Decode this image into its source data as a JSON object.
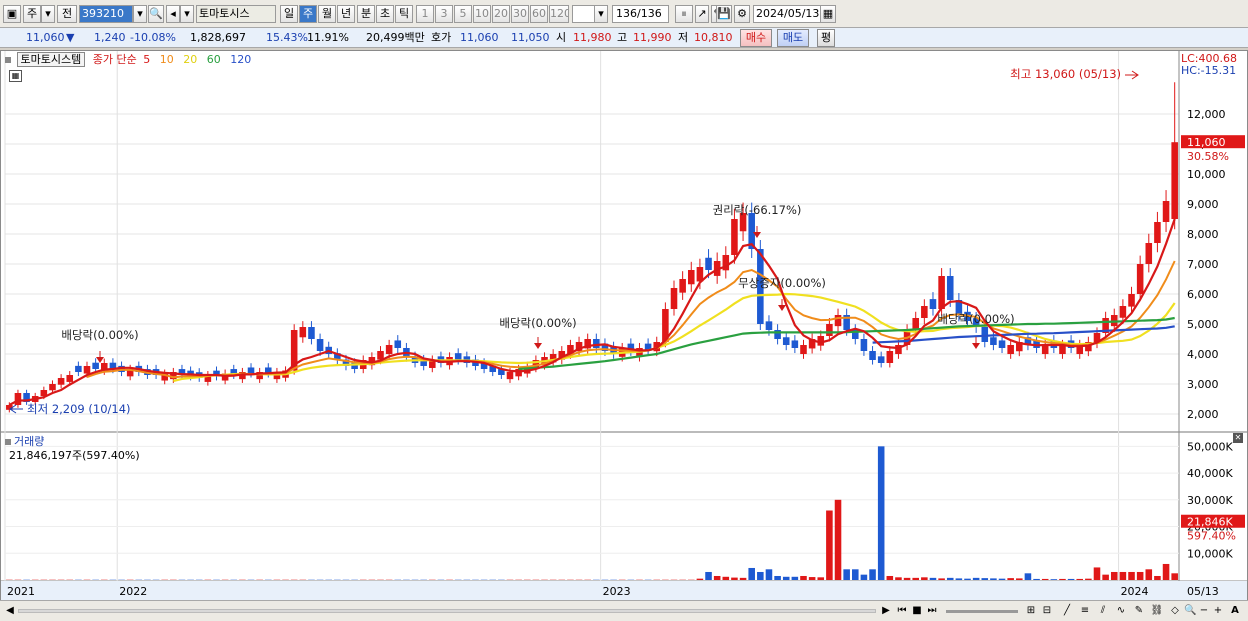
{
  "toolbar": {
    "market": "주",
    "prev": "전",
    "code": "393210",
    "stock_name": "토마토시스",
    "periods": [
      "일",
      "주",
      "월",
      "년",
      "분",
      "초",
      "틱"
    ],
    "selected_period": "주",
    "intervals": [
      "1",
      "3",
      "5",
      "10",
      "20",
      "30",
      "60",
      "120"
    ],
    "count": "136",
    "count_total": "/136",
    "date": "2024/05/13"
  },
  "info": {
    "price": "11,060",
    "change": "1,240",
    "change_pct": "-10.08%",
    "volume": "1,828,697",
    "vol_ratio": "15.43%",
    "turnover": "11.91%",
    "amount": "20,499백만",
    "ask_label": "호가",
    "ask1": "11,060",
    "ask2": "11,050",
    "open_label": "시",
    "open": "11,980",
    "high_label": "고",
    "high": "11,990",
    "low_label": "저",
    "low": "10,810",
    "buy": "매수",
    "sell": "매도",
    "avg": "평"
  },
  "legend": {
    "name": "토마토시스템",
    "type": "종가 단순",
    "ma": [
      {
        "label": "5",
        "color": "#d81818"
      },
      {
        "label": "10",
        "color": "#f08c1a"
      },
      {
        "label": "20",
        "color": "#f0e020"
      },
      {
        "label": "60",
        "color": "#2aa040"
      },
      {
        "label": "120",
        "color": "#2850c8"
      }
    ]
  },
  "lc_label": "LC:400.68",
  "hc_label": "HC:-15.31",
  "current_price": "11,060",
  "current_pct": "30.58%",
  "volume_panel": {
    "title": "거래량",
    "value": "21,846,197주(597.40%)",
    "current_label": "21,846K",
    "current_pct": "597.40%"
  },
  "annotations": {
    "high": "최고 13,060 (05/13)",
    "low": "최저 2,209 (10/14)",
    "div1": "배당락(0.00%)",
    "div2": "배당락(0.00%)",
    "rights": "권리락(-66.17%)",
    "bonus": "무상증자(0.00%)",
    "div3": "배당락(0.00%)"
  },
  "bottom": {
    "date": "05/13"
  },
  "chart_data": {
    "type": "candlestick",
    "x_labels": [
      "2021",
      "2022",
      "2023",
      "2024"
    ],
    "y_ticks": [
      2000,
      3000,
      4000,
      5000,
      6000,
      7000,
      8000,
      9000,
      10000,
      11000,
      12000
    ],
    "volume_ticks": [
      "10,000K",
      "20,000K",
      "30,000K",
      "40,000K",
      "50,000K"
    ],
    "y_range": [
      1500,
      13500
    ],
    "series": [
      {
        "name": "종가",
        "values": [
          2300,
          2700,
          2400,
          2600,
          2800,
          3000,
          3200,
          3300,
          3400,
          3600,
          3500,
          3700,
          3500,
          3400,
          3500,
          3400,
          3300,
          3300,
          3350,
          3400,
          3300,
          3250,
          3200,
          3300,
          3250,
          3350,
          3300,
          3400,
          3350,
          3400,
          3350,
          3400,
          3450,
          4800,
          4900,
          4500,
          4100,
          4000,
          3800,
          3600,
          3500,
          3800,
          3900,
          4100,
          4300,
          4200,
          3900,
          3700,
          3600,
          3800,
          3700,
          3900,
          3800,
          3700,
          3600,
          3500,
          3400,
          3300,
          3400,
          3500,
          3600,
          3800,
          3900,
          4000,
          4100,
          4300,
          4400,
          4500,
          4200,
          4100,
          4000,
          4200,
          4100,
          4200,
          4100,
          4400,
          5500,
          6200,
          6500,
          6800,
          6900,
          6800,
          7100,
          7300,
          8500,
          8700,
          7500,
          5000,
          4800,
          4500,
          4300,
          4200,
          4300,
          4500,
          4600,
          5000,
          5300,
          4800,
          4500,
          4100,
          3800,
          3700,
          4100,
          4300,
          4800,
          5200,
          5600,
          5500,
          6600,
          5800,
          5300,
          5100,
          4900,
          4400,
          4300,
          4200,
          4300,
          4400,
          4300,
          4200,
          4300,
          4200,
          4300,
          4200,
          4300,
          4400,
          4700,
          5200,
          5300,
          5600,
          6000,
          7000,
          7700,
          8400,
          9100,
          11060
        ]
      }
    ],
    "volume_values": [
      0.1,
      0.1,
      0.1,
      0.1,
      0.1,
      0.1,
      0.1,
      0.1,
      0.1,
      0.1,
      0.1,
      0.1,
      0.1,
      0.1,
      0.1,
      0.1,
      0.1,
      0.1,
      0.1,
      0.1,
      0.1,
      0.1,
      0.1,
      0.1,
      0.1,
      0.1,
      0.1,
      0.1,
      0.1,
      0.1,
      0.1,
      0.1,
      0.1,
      0.1,
      0.1,
      0.1,
      0.1,
      0.1,
      0.1,
      0.1,
      0.1,
      0.1,
      0.1,
      0.1,
      0.1,
      0.1,
      0.1,
      0.1,
      0.1,
      0.1,
      0.1,
      0.1,
      0.1,
      0.1,
      0.1,
      0.1,
      0.1,
      0.1,
      0.1,
      0.1,
      0.1,
      0.1,
      0.1,
      0.1,
      0.1,
      0.1,
      0.1,
      0.1,
      0.1,
      0.1,
      0.1,
      0.1,
      0.1,
      0.1,
      0.1,
      0.1,
      0.1,
      0.1,
      0.1,
      0.1,
      0.5,
      3,
      1.5,
      1.2,
      0.9,
      0.8,
      4.5,
      3,
      4,
      1.5,
      1.2,
      1.2,
      1.5,
      1.1,
      1,
      26,
      30,
      4,
      4,
      2,
      4,
      50,
      1.5,
      1,
      0.8,
      0.8,
      1,
      0.8,
      0.6,
      0.8,
      0.6,
      0.5,
      0.8,
      0.7,
      0.6,
      0.5,
      0.7,
      0.6,
      2.5,
      0.4,
      0.4,
      0.3,
      0.4,
      0.4,
      0.4,
      0.5,
      4.7,
      2,
      3,
      3,
      3,
      3,
      4,
      1.5,
      6,
      2.5,
      7,
      3,
      12,
      2,
      21.8
    ],
    "up": [
      1,
      1,
      0,
      1,
      1,
      1,
      1,
      1,
      0,
      1,
      0,
      1,
      0,
      0,
      1,
      0,
      0,
      0,
      1,
      1,
      0,
      0,
      0,
      1,
      0,
      1,
      0,
      1,
      0,
      1,
      0,
      1,
      1,
      1,
      1,
      0,
      0,
      0,
      0,
      0,
      0,
      1,
      1,
      1,
      1,
      0,
      0,
      0,
      0,
      1,
      0,
      1,
      0,
      0,
      0,
      0,
      0,
      0,
      1,
      1,
      1,
      1,
      1,
      1,
      1,
      1,
      1,
      1,
      0,
      0,
      0,
      1,
      0,
      1,
      0,
      1,
      1,
      1,
      1,
      1,
      1,
      0,
      1,
      1,
      1,
      1,
      0,
      0,
      0,
      0,
      0,
      0,
      1,
      1,
      1,
      1,
      1,
      0,
      0,
      0,
      0,
      0,
      1,
      1,
      1,
      1,
      1,
      0,
      1,
      0,
      0,
      0,
      0,
      0,
      0,
      0,
      1,
      1,
      0,
      0,
      1,
      0,
      1,
      0,
      1,
      1,
      1,
      1,
      1,
      1,
      1,
      1,
      1,
      1,
      1,
      1
    ],
    "ma5": [
      2300,
      2450,
      2450,
      2500,
      2560,
      2700,
      2800,
      2980,
      3140,
      3300,
      3400,
      3480,
      3500,
      3540,
      3540,
      3500,
      3440,
      3400,
      3370,
      3350,
      3330,
      3320,
      3300,
      3300,
      3300,
      3270,
      3280,
      3320,
      3320,
      3350,
      3360,
      3380,
      3390,
      3640,
      3820,
      3900,
      4000,
      4100,
      4000,
      3900,
      3800,
      3750,
      3720,
      3780,
      3920,
      4000,
      4040,
      4000,
      3850,
      3800,
      3740,
      3740,
      3760,
      3760,
      3740,
      3700,
      3600,
      3500,
      3440,
      3420,
      3440,
      3500,
      3600,
      3730,
      3900,
      4020,
      4180,
      4270,
      4300,
      4320,
      4240,
      4200,
      4160,
      4120,
      4120,
      4200,
      4460,
      4840,
      5340,
      5880,
      6380,
      6640,
      6820,
      6920,
      7120,
      7600,
      7660,
      7340,
      6940,
      6500,
      5660,
      4960,
      4620,
      4460,
      4380,
      4460,
      4660,
      4760,
      4840,
      4760,
      4540,
      4260,
      4220,
      4200,
      4320,
      4600,
      4940,
      5120,
      5540,
      5740,
      5760,
      5660,
      5540,
      5100,
      4760,
      4600,
      4460,
      4360,
      4320,
      4290,
      4300,
      4300,
      4300,
      4260,
      4260,
      4280,
      4380,
      4560,
      4800,
      5060,
      5360,
      5820,
      6340,
      6920,
      7680,
      8500
    ],
    "ma20": [
      null,
      null,
      null,
      null,
      null,
      null,
      null,
      null,
      null,
      null,
      null,
      null,
      null,
      null,
      null,
      null,
      null,
      null,
      null,
      3100,
      3170,
      3200,
      3230,
      3270,
      3290,
      3310,
      3330,
      3340,
      3330,
      3330,
      3320,
      3320,
      3330,
      3400,
      3480,
      3540,
      3580,
      3610,
      3630,
      3640,
      3650,
      3660,
      3680,
      3710,
      3740,
      3760,
      3780,
      3790,
      3790,
      3790,
      3790,
      3790,
      3790,
      3780,
      3770,
      3760,
      3740,
      3720,
      3710,
      3700,
      3710,
      3730,
      3760,
      3800,
      3850,
      3900,
      3940,
      3980,
      4000,
      4010,
      4020,
      4040,
      4060,
      4080,
      4120,
      4200,
      4300,
      4420,
      4580,
      4760,
      4950,
      5120,
      5300,
      5480,
      5680,
      5860,
      5940,
      5960,
      5970,
      5980,
      6000,
      5990,
      5960,
      5930,
      5880,
      5810,
      5740,
      5660,
      5580,
      5440,
      5250,
      5050,
      4900,
      4800,
      4760,
      4740,
      4760,
      4770,
      4830,
      4860,
      4880,
      4900,
      4930,
      4940,
      4950,
      4930,
      4880,
      4800,
      4700,
      4600,
      4500,
      4430,
      4380,
      4340,
      4330,
      4340,
      4360,
      4400,
      4420,
      4440,
      4480,
      4600,
      4780,
      5010,
      5300,
      5700
    ],
    "ma60": [
      null,
      null,
      null,
      null,
      null,
      null,
      null,
      null,
      null,
      null,
      null,
      null,
      null,
      null,
      null,
      null,
      null,
      null,
      null,
      null,
      null,
      null,
      null,
      null,
      null,
      null,
      null,
      null,
      null,
      null,
      null,
      null,
      null,
      null,
      null,
      null,
      null,
      null,
      null,
      null,
      null,
      null,
      null,
      null,
      null,
      null,
      null,
      null,
      null,
      null,
      null,
      null,
      null,
      null,
      null,
      null,
      null,
      null,
      null,
      3500,
      3520,
      3540,
      3560,
      3580,
      3610,
      3640,
      3670,
      3700,
      3730,
      3760,
      3800,
      3840,
      3880,
      3920,
      3960,
      4000,
      4080,
      4160,
      4240,
      4320,
      4380,
      4440,
      4500,
      4560,
      4620,
      4680,
      4700,
      4710,
      4720,
      4720,
      4720,
      4720,
      4720,
      4720,
      4720,
      4720,
      4720,
      4730,
      4740,
      4750,
      4760,
      4770,
      4780,
      4790,
      4800,
      4820,
      4840,
      4860,
      4880,
      4900,
      4920,
      4930,
      4940,
      4950,
      4960,
      4970,
      4980,
      4990,
      5000,
      5000,
      5010,
      5010,
      5020,
      5030,
      5040,
      5050,
      5060,
      5070,
      5080,
      5090,
      5100,
      5110,
      5120,
      5130,
      5150,
      5200
    ]
  }
}
